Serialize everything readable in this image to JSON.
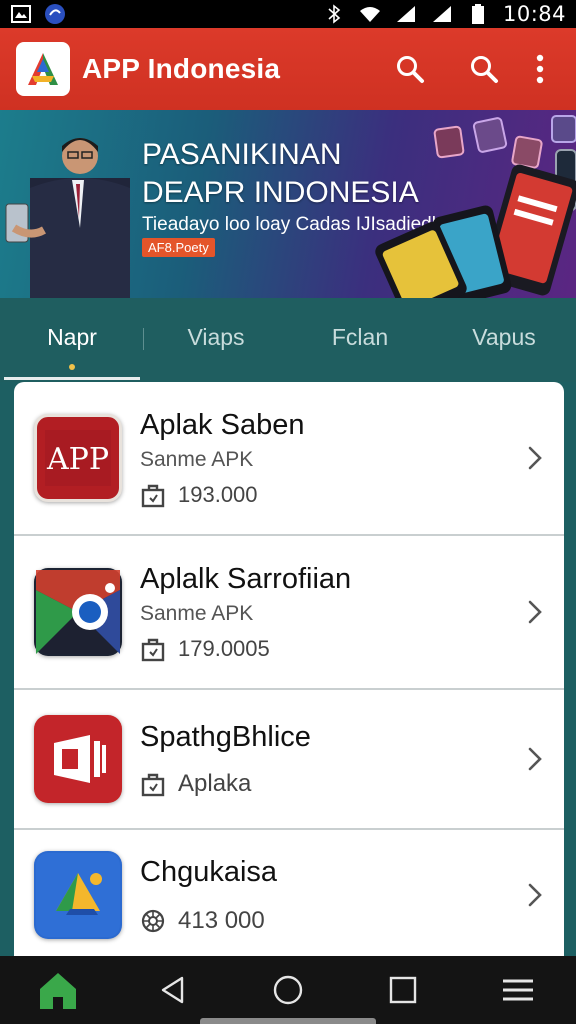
{
  "status_bar": {
    "time": "10:84"
  },
  "app_bar": {
    "title": "APP Indonesia"
  },
  "banner": {
    "title_line1": "PASANIKINAN",
    "title_line2": "DEAPR INDONESIA",
    "subtitle": "Tieadayo loo loay Cadas IJIsadiedls",
    "cta": "AF8.Poety"
  },
  "tabs": [
    {
      "label": "Napr"
    },
    {
      "label": "Viaps"
    },
    {
      "label": "Fclan"
    },
    {
      "label": "Vapus"
    }
  ],
  "apps": [
    {
      "name": "Aplak Saben",
      "sub": "Sanme APK",
      "meta": "193.000",
      "icon_text": "APP"
    },
    {
      "name": "Aplalk Sarrofiian",
      "sub": "Sanme APK",
      "meta": "179.0005"
    },
    {
      "name": "SpathgBhlice",
      "meta": "Aplaka"
    },
    {
      "name": "Chgukaisa",
      "meta": "413 000"
    }
  ],
  "colors": {
    "app_bar": "#d4342a",
    "background": "#1d5f62",
    "nav_bar": "#141414",
    "home_icon": "#3aa84a"
  }
}
